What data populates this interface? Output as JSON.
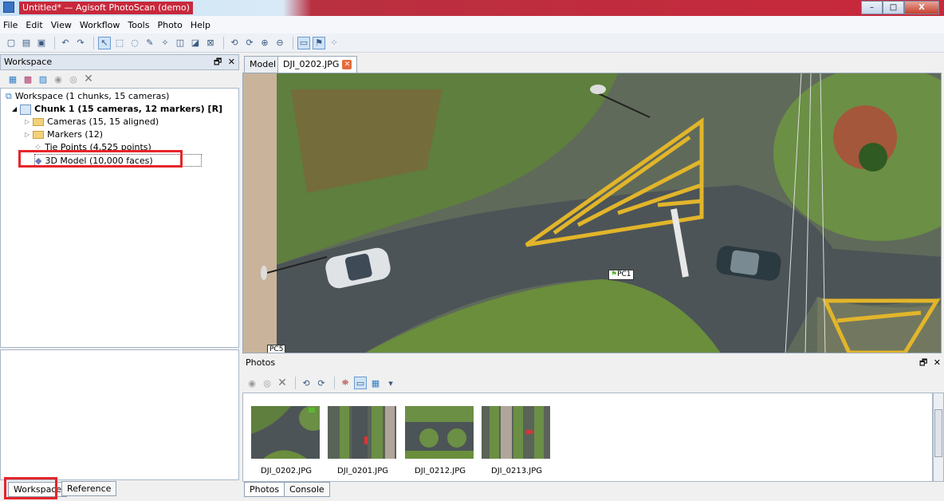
{
  "window": {
    "title": "Untitled* — Agisoft PhotoScan (demo)",
    "min": "–",
    "max": "□",
    "close": "X"
  },
  "menu": [
    "File",
    "Edit",
    "View",
    "Workflow",
    "Tools",
    "Photo",
    "Help"
  ],
  "workspace_panel": {
    "title": "Workspace",
    "tree": [
      {
        "label": "Workspace (1 chunks, 15 cameras)"
      },
      {
        "label": "Chunk 1 (15 cameras, 12 markers) [R]"
      },
      {
        "label": "Cameras (15, 15 aligned)"
      },
      {
        "label": "Markers (12)"
      },
      {
        "label": "Tie Points (4,525 points)"
      },
      {
        "label": "3D Model (10,000 faces)"
      }
    ],
    "bottom_tabs": [
      "Workspace",
      "Reference"
    ]
  },
  "view_tabs": [
    "Model",
    "DJI_0202.JPG"
  ],
  "markers": [
    "PC1",
    "PC5"
  ],
  "photos_panel": {
    "title": "Photos",
    "items": [
      "DJI_0202.JPG",
      "DJI_0201.JPG",
      "DJI_0212.JPG",
      "DJI_0213.JPG"
    ],
    "bottom_tabs": [
      "Photos",
      "Console"
    ]
  },
  "colors": {
    "highlight": "#e5252a",
    "title_red": "#c8283b",
    "panel_blue": "#dfe6ef"
  }
}
